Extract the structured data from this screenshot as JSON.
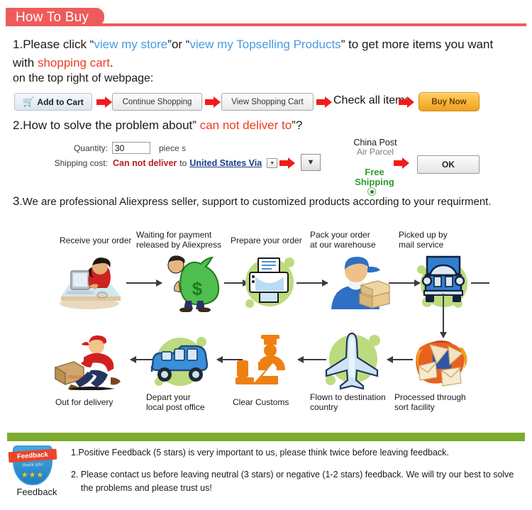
{
  "header": {
    "title": "How To Buy",
    "bar_color": "#ef5b5b"
  },
  "step1": {
    "number": "1.",
    "text_a": "Please click ",
    "quote_open": "“",
    "link1": "view my store",
    "quote_close": "”",
    "text_b": "or ",
    "link2": "view my Topselling Products",
    "text_c": " to get  more items you want",
    "text_d": "with ",
    "highlight": "shopping cart",
    "text_e": ".",
    "subline": "on the top right of webpage:",
    "link_color": "#4a9ae0",
    "highlight_color": "#ee3b24"
  },
  "buttons": {
    "add_to_cart": "Add to Cart",
    "cart_icon": "shopping-cart-icon",
    "continue_shopping": "Continue Shopping",
    "view_shopping_cart": "View Shopping Cart",
    "check_all_items": "Check all items",
    "buy_now": "Buy Now",
    "arrow_color": "#f21b1b"
  },
  "step2": {
    "number": "2.",
    "text_a": "How to solve the problem about",
    "quote": "”",
    "highlight": "can not deliver to",
    "tail": "”?",
    "quantity_label": "Quantity:",
    "quantity_value": "30",
    "quantity_unit": "piece s",
    "shipping_label": "Shipping cost:",
    "shipping_status": "Can not deliver",
    "shipping_to": "to",
    "shipping_country": "United States Via",
    "dropdown_caret": "▼",
    "big_dropdown_caret": "▼",
    "carrier_title": "China Post",
    "carrier_sub": "Air Parcel",
    "free_shipping": "Free\nShipping",
    "free_shipping_line1": "Free",
    "free_shipping_line2": "Shipping",
    "radio_selected": true,
    "ok_button": "OK"
  },
  "step3": {
    "number": "3",
    "text": ".We are professional Aliexpress seller, support to customized products according to your requirment."
  },
  "flow": {
    "blob_color": "#bcdb7e",
    "arrow_color": "#3b3b46",
    "top_row": [
      {
        "label_line1": "Receive your order",
        "label_line2": "",
        "icon": "person-at-computer-icon"
      },
      {
        "label_line1": "Waiting for payment",
        "label_line2": "released by Aliexpress",
        "icon": "money-bag-icon"
      },
      {
        "label_line1": "Prepare your order",
        "label_line2": "",
        "icon": "printer-icon"
      },
      {
        "label_line1": "Pack your order",
        "label_line2": "at our warehouse",
        "icon": "worker-with-boxes-icon"
      },
      {
        "label_line1": "Picked up by",
        "label_line2": "mail service",
        "icon": "delivery-truck-icon"
      }
    ],
    "bottom_row": [
      {
        "label_line1": "Out for delivery",
        "label_line2": "",
        "icon": "running-courier-icon"
      },
      {
        "label_line1": "Depart your",
        "label_line2": "local post office",
        "icon": "blue-van-icon"
      },
      {
        "label_line1": "Clear Customs",
        "label_line2": "",
        "icon": "customs-officer-icon"
      },
      {
        "label_line1": "Flown to destination",
        "label_line2": "country",
        "icon": "airplane-icon"
      },
      {
        "label_line1": "Processed through",
        "label_line2": "sort facility",
        "icon": "mail-sorting-icon"
      }
    ]
  },
  "feedback": {
    "bar_color": "#7cab2e",
    "badge_title": "Feedback",
    "badge_sub": "thank you",
    "badge_stars": "★★★",
    "caption": "Feedback",
    "item1": "1.Positive Feedback (5 stars) is very important to us, please think twice before leaving feedback.",
    "item2_line1": "2. Please contact us before leaving neutral (3 stars) or negative (1-2 stars) feedback. We will try our best to solve",
    "item2_line2": "the problems and please trust us!"
  }
}
